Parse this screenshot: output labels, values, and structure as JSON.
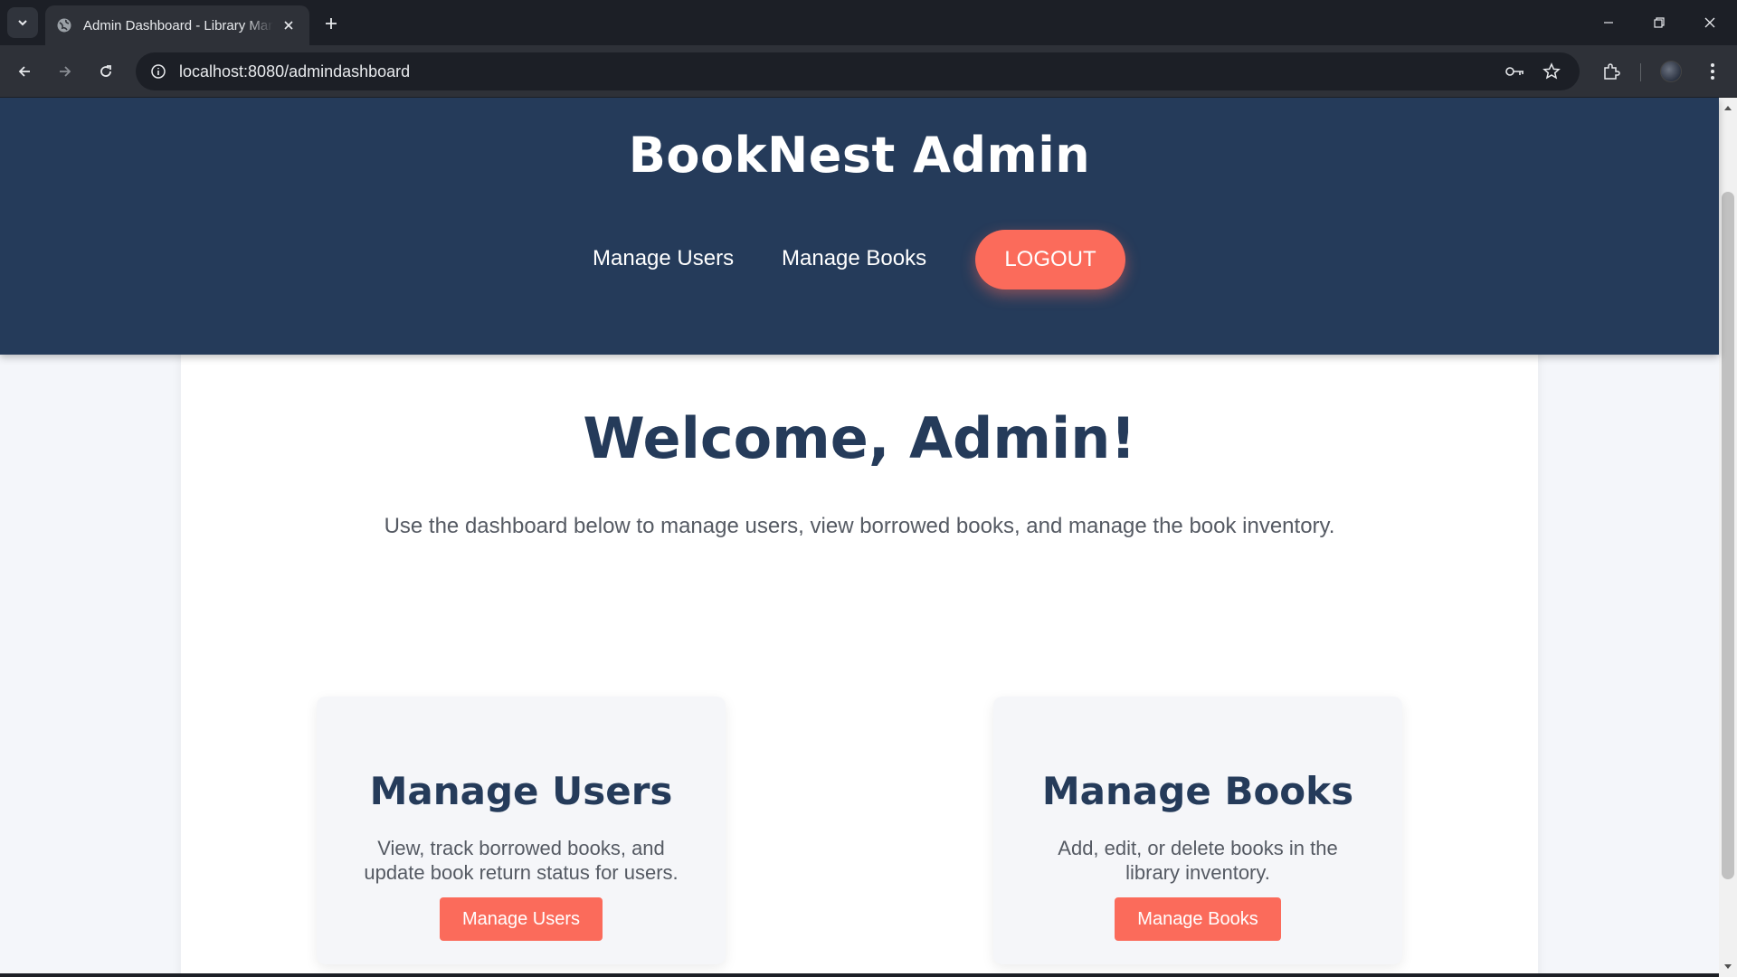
{
  "browser": {
    "tab_title": "Admin Dashboard - Library Management",
    "url": "localhost:8080/admindashboard",
    "icons": {
      "tab_list": "chevron-down-icon",
      "favicon": "globe-icon",
      "close": "close-icon",
      "new_tab": "plus-icon",
      "back": "back-arrow-icon",
      "forward": "forward-arrow-icon",
      "reload": "reload-icon",
      "site_info": "info-icon",
      "password": "key-icon",
      "bookmark": "star-icon",
      "extensions": "puzzle-icon",
      "menu": "kebab-menu-icon"
    }
  },
  "header": {
    "brand": "BookNest Admin",
    "nav": {
      "manage_users": "Manage Users",
      "manage_books": "Manage Books",
      "logout": "LOGOUT"
    }
  },
  "main": {
    "welcome": "Welcome, Admin!",
    "intro": "Use the dashboard below to manage users, view borrowed books, and manage the book inventory.",
    "cards": [
      {
        "title": "Manage Users",
        "description": "View, track borrowed books, and update book return status for users.",
        "button": "Manage Users"
      },
      {
        "title": "Manage Books",
        "description": "Add, edit, or delete books in the library inventory.",
        "button": "Manage Books"
      }
    ]
  },
  "colors": {
    "header_bg": "#253b5a",
    "accent": "#fb6b5b",
    "heading": "#253b5a",
    "body_text": "#555a63",
    "card_bg": "#f5f6f9"
  }
}
